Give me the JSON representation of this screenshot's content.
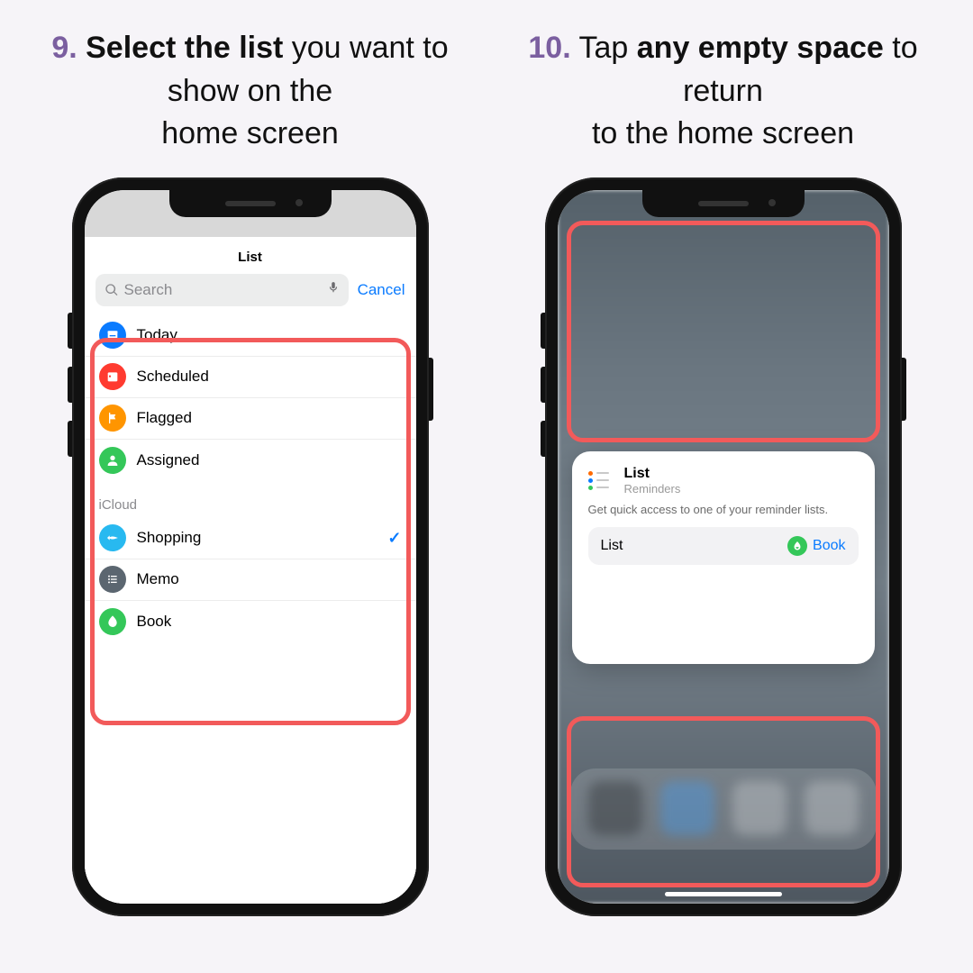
{
  "steps": [
    {
      "number": "9.",
      "bold": "Select the list",
      "rest1": " you want to show on the",
      "rest2": "home screen"
    },
    {
      "number": "10.",
      "bold": "any empty space",
      "pre": "Tap ",
      "rest1": " to return",
      "rest2": "to the home screen"
    }
  ],
  "screen1": {
    "title": "List",
    "search_placeholder": "Search",
    "cancel": "Cancel",
    "smart_lists": [
      {
        "name": "Today",
        "color": "#0a7bff",
        "icon": "today"
      },
      {
        "name": "Scheduled",
        "color": "#ff3b30",
        "icon": "calendar"
      },
      {
        "name": "Flagged",
        "color": "#ff9500",
        "icon": "flag"
      },
      {
        "name": "Assigned",
        "color": "#34c759",
        "icon": "person"
      }
    ],
    "section_label": "iCloud",
    "user_lists": [
      {
        "name": "Shopping",
        "color": "#28b9f0",
        "icon": "fish",
        "checked": true
      },
      {
        "name": "Memo",
        "color": "#5b6670",
        "icon": "list",
        "checked": false
      },
      {
        "name": "Book",
        "color": "#34c759",
        "icon": "leaf",
        "checked": false
      }
    ]
  },
  "screen2": {
    "widget_title": "List",
    "widget_subtitle": "Reminders",
    "widget_desc": "Get quick access to one of your reminder lists.",
    "row_left": "List",
    "row_right": "Book"
  }
}
